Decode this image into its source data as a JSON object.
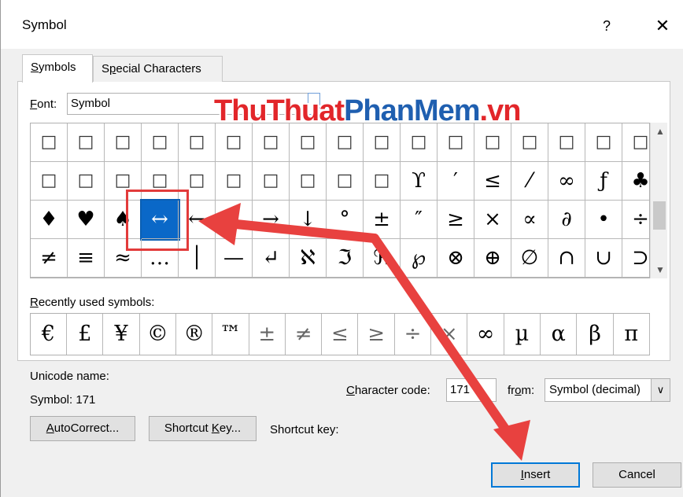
{
  "window": {
    "title": "Symbol",
    "help": "?",
    "close": "✕"
  },
  "tabs": [
    {
      "label": "Symbols",
      "mnemonic": "S",
      "rest": "ymbols"
    },
    {
      "label": "Special Characters",
      "mnemonic_pre": "S",
      "mnemonic": "p",
      "rest": "ecial Characters"
    }
  ],
  "font": {
    "label_mnemonic": "F",
    "label_rest": "ont:",
    "value": "Symbol"
  },
  "watermark": {
    "part1": "ThuThuat",
    "part2": "PhanMem",
    "part3": ".vn"
  },
  "grid": {
    "rows": [
      [
        "□",
        "□",
        "□",
        "□",
        "□",
        "□",
        "□",
        "□",
        "□",
        "□",
        "□",
        "□",
        "□",
        "□",
        "□",
        "□",
        "□"
      ],
      [
        "□",
        "□",
        "□",
        "□",
        "□",
        "□",
        "□",
        "□",
        "□",
        "□",
        "ϒ",
        "′",
        "≤",
        "⁄",
        "∞",
        "ƒ",
        "♣"
      ],
      [
        "♦",
        "♥",
        "♠",
        "↔",
        "←",
        "↑",
        "→",
        "↓",
        "°",
        "±",
        "″",
        "≥",
        "×",
        "∝",
        "∂",
        "•",
        "÷"
      ],
      [
        "≠",
        "≡",
        "≈",
        "…",
        "│",
        "—",
        "↵",
        "ℵ",
        "ℑ",
        "ℜ",
        "℘",
        "⊗",
        "⊕",
        "∅",
        "∩",
        "∪",
        "⊃"
      ]
    ],
    "selected": {
      "row": 2,
      "col": 3
    }
  },
  "recent": {
    "label": "Recently used symbols:",
    "label_mnemonic": "R",
    "label_rest": "ecently used symbols:",
    "symbols": [
      "€",
      "£",
      "¥",
      "©",
      "®",
      "™",
      "±",
      "≠",
      "≤",
      "≥",
      "÷",
      "×",
      "∞",
      "µ",
      "α",
      "β",
      "π"
    ]
  },
  "unicode": {
    "name_label": "Unicode name:",
    "symbol_text": "Symbol: 171"
  },
  "character_code": {
    "label_mnemonic": "C",
    "label_rest": "haracter code:",
    "value": "171"
  },
  "from": {
    "label_pre": "fr",
    "label_mnemonic": "o",
    "label_rest": "m:",
    "value": "Symbol (decimal)"
  },
  "buttons": {
    "autocorrect": {
      "mnemonic": "A",
      "rest": "utoCorrect..."
    },
    "shortcut_key": {
      "pre": "Shortcut ",
      "mnemonic": "K",
      "rest": "ey..."
    },
    "insert": {
      "mnemonic": "I",
      "rest": "nsert"
    },
    "cancel": "Cancel"
  },
  "shortcut_key_label": "Shortcut key:",
  "colors": {
    "accent": "#0078d7",
    "selection": "#0a68c8",
    "annotation": "#e23b3b"
  },
  "icons": {
    "scroll_up": "chevron-up-icon",
    "scroll_down": "chevron-down-icon",
    "dropdown": "chevron-down-icon"
  }
}
